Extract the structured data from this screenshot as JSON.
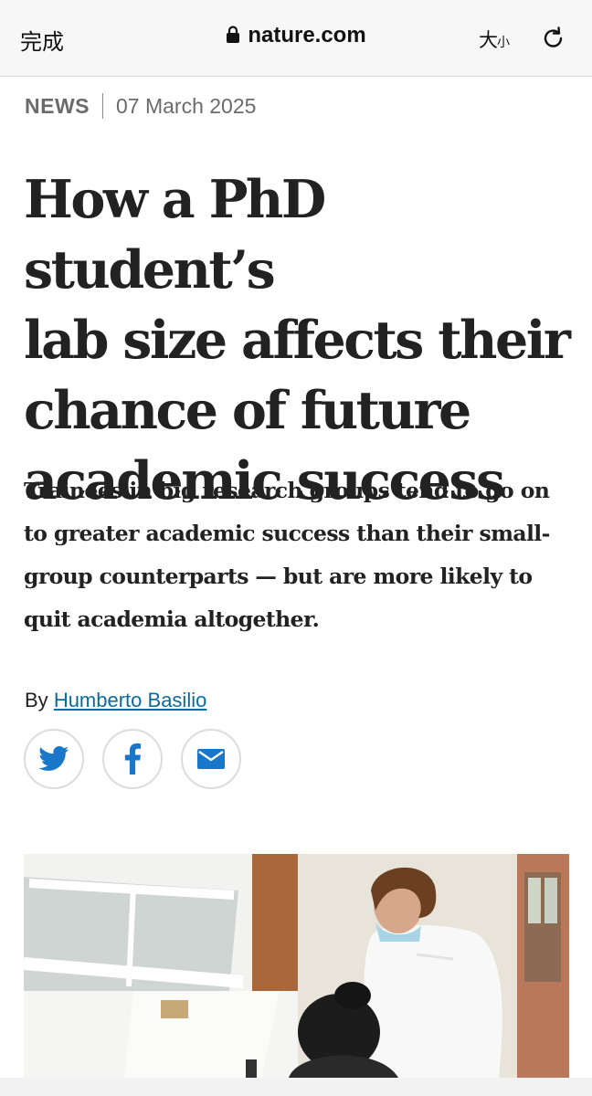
{
  "browser": {
    "done_label": "完成",
    "url": "nature.com",
    "text_size_big": "大",
    "text_size_small": "小"
  },
  "article": {
    "type": "NEWS",
    "date": "07 March 2025",
    "headline_lines": [
      "How a PhD student’s",
      "lab size affects their",
      "chance of future",
      "academic success"
    ],
    "standfirst_lines": [
      "Trainees in big research groups tend to go on",
      "to greater academic success than their small-",
      "group counterparts — but are more likely to",
      "quit academia altogether."
    ],
    "byline_prefix": "By",
    "author": "Humberto Basilio"
  },
  "share": {
    "icons": [
      "twitter-icon",
      "facebook-icon",
      "email-icon"
    ]
  },
  "colors": {
    "link": "#0b6b9e",
    "twitter_blue": "#1877c9",
    "headline": "#222222"
  }
}
